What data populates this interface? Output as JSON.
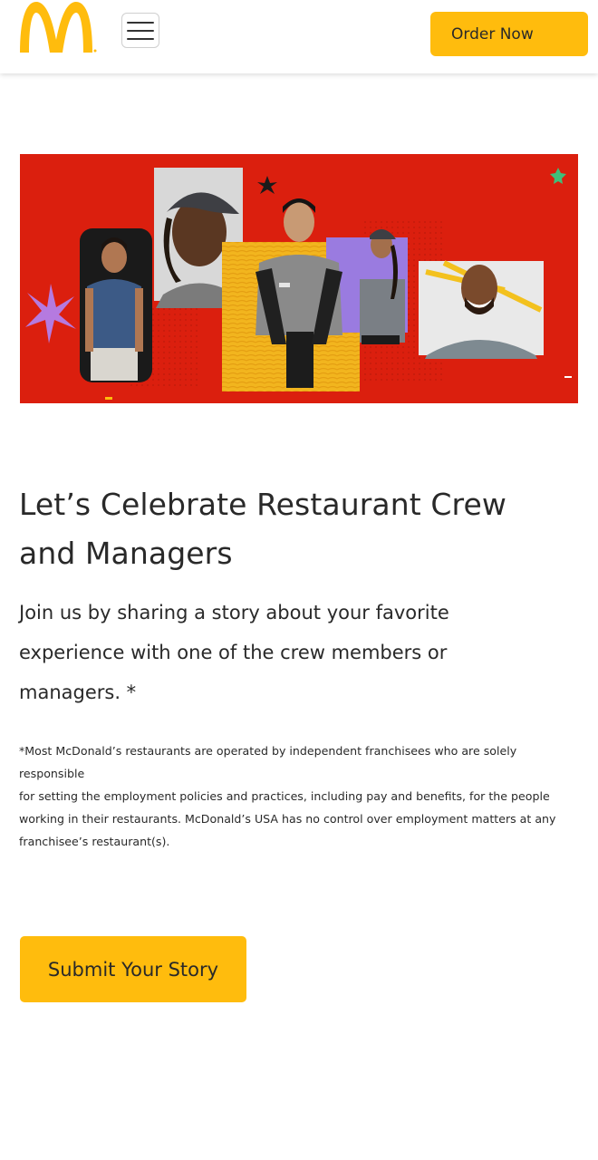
{
  "brand": {
    "logo_icon": "golden-arches-icon",
    "accent_color": "#FFBC0D",
    "hero_color": "#DB1F0E"
  },
  "header": {
    "menu_icon": "hamburger-menu-icon",
    "order_label": "Order Now"
  },
  "main": {
    "headline_line1": "Let’s Celebrate Restaurant Crew",
    "headline_line2": "and Managers",
    "intro_line1": "Join us by sharing a story about your favorite",
    "intro_line2": "experience with one of the crew members or",
    "intro_line3": "managers. *",
    "disclaimer_line1": "*Most McDonald’s restaurants are operated by independent franchisees who are solely responsible",
    "disclaimer_line2": "for setting the employment policies and practices,  including pay and benefits,  for the people",
    "disclaimer_line3": "working in their restaurants.  McDonald’s USA has no control over employment matters at any",
    "disclaimer_line4": "franchisee’s restaurant(s).",
    "submit_label": "Submit Your Story"
  }
}
